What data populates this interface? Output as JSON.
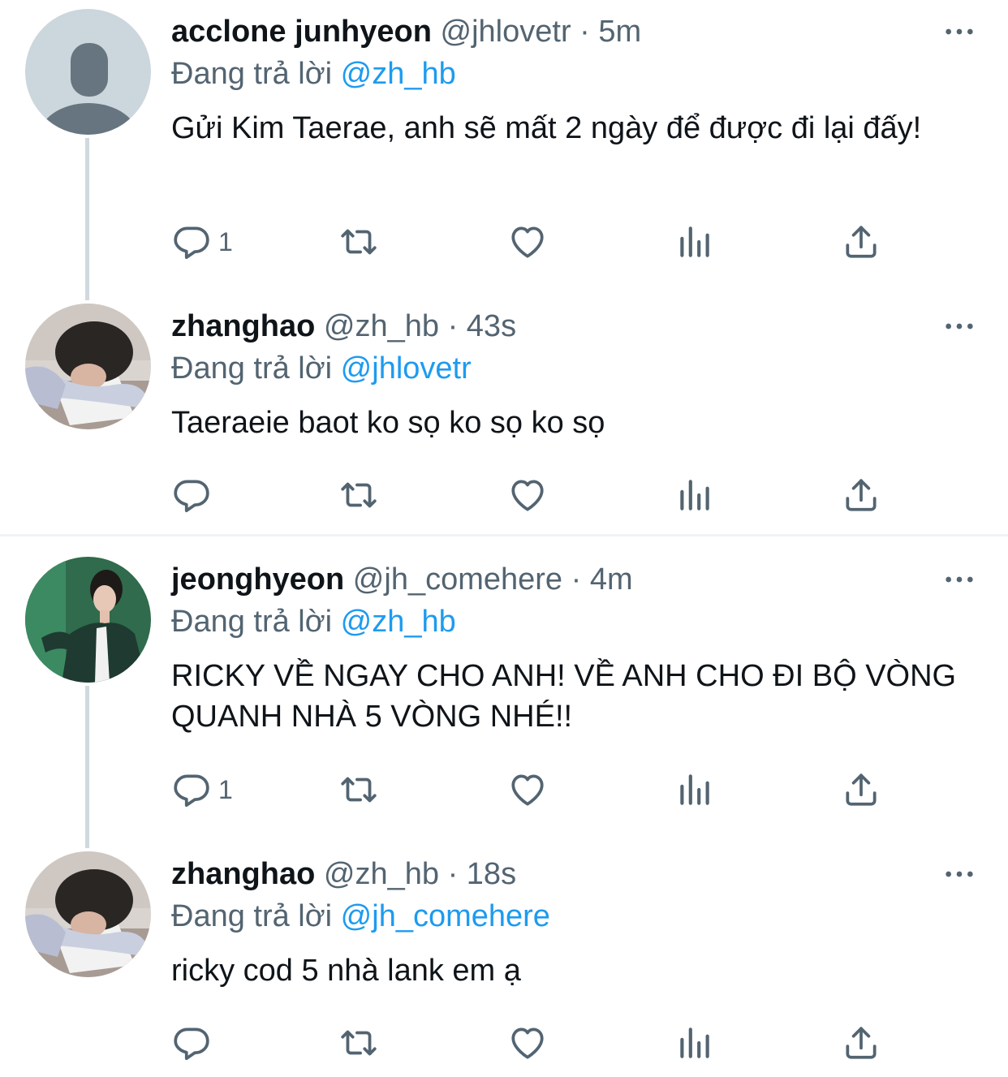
{
  "tweets": [
    {
      "name": "acclone junhyeon",
      "handle": "@jhlovetr",
      "dot": "·",
      "time": "5m",
      "reply_prefix": "Đang trả lời",
      "reply_to": "@zh_hb",
      "text": "Gửi Kim Taerae, anh sẽ mất 2 ngày để được đi lại đấy!",
      "reply_count": "1",
      "avatar": "default-avatar"
    },
    {
      "name": "zhanghao",
      "handle": "@zh_hb",
      "dot": "·",
      "time": "43s",
      "reply_prefix": "Đang trả lời",
      "reply_to": "@jhlovetr",
      "text": "Taeraeie baot ko sọ ko sọ ko sọ",
      "reply_count": "",
      "avatar": "photo-avatar-zhanghao"
    },
    {
      "name": "jeonghyeon",
      "handle": "@jh_comehere",
      "dot": "·",
      "time": "4m",
      "reply_prefix": "Đang trả lời",
      "reply_to": "@zh_hb",
      "text": "RICKY VỀ NGAY CHO ANH! VỀ ANH CHO ĐI BỘ VÒNG QUANH NHÀ 5 VÒNG NHÉ!!",
      "reply_count": "1",
      "avatar": "photo-avatar-jeonghyeon"
    },
    {
      "name": "zhanghao",
      "handle": "@zh_hb",
      "dot": "·",
      "time": "18s",
      "reply_prefix": "Đang trả lời",
      "reply_to": "@jh_comehere",
      "text": "ricky cod 5 nhà lank em ạ",
      "reply_count": "",
      "avatar": "photo-avatar-zhanghao"
    }
  ],
  "colors": {
    "text": "#0f1419",
    "secondary": "#536471",
    "accent": "#1d9bf0",
    "thread_line": "#cfd9de",
    "separator": "#eff3f4"
  },
  "icons": [
    "reply-icon",
    "retweet-icon",
    "like-icon",
    "analytics-icon",
    "share-icon",
    "more-icon"
  ]
}
